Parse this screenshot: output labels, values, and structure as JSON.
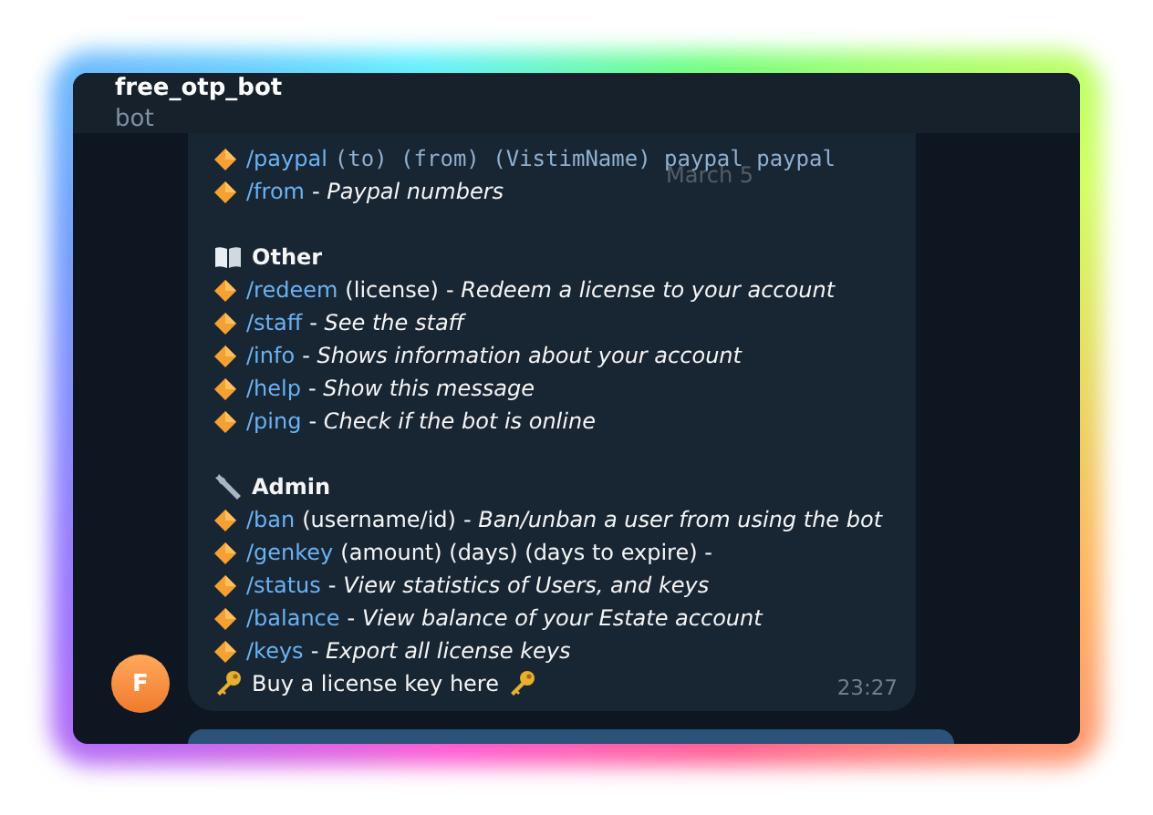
{
  "header": {
    "title": "free_otp_bot",
    "subtitle": "bot"
  },
  "date_badge": "March 5",
  "avatar": {
    "letter": "F"
  },
  "message": {
    "sections": [
      {
        "lines": [
          {
            "command": "/paypal",
            "args": "(to) (from) (VistimName) paypal paypal",
            "kind": "mono"
          },
          {
            "command": "/from",
            "description": "- *Paypal numbers*"
          }
        ]
      },
      {
        "heading": "Other",
        "lines": [
          {
            "command": "/redeem",
            "args": "(license)",
            "kind": "plain",
            "description": "- *Redeem a license to your account*"
          },
          {
            "command": "/staff",
            "description": "- *See the staff*"
          },
          {
            "command": "/info",
            "description": "- *Shows information about your account*"
          },
          {
            "command": "/help",
            "description": "- *Show this message*"
          },
          {
            "command": "/ping",
            "description": "- *Check if the bot is online*"
          }
        ]
      },
      {
        "heading": "Admin",
        "lines": [
          {
            "command": "/ban",
            "args": "(username/id)",
            "kind": "plain",
            "description": "- *Ban/unban a user from using the bot*"
          },
          {
            "command": "/genkey",
            "args": "(amount) (days) (days to expire) -",
            "kind": "plain"
          },
          {
            "command": "/status",
            "description": "- *View statistics of Users, and keys*"
          },
          {
            "command": "/balance",
            "description": "- *View balance of your Estate account*"
          },
          {
            "command": "/keys",
            "description": "- *Export all license keys*"
          }
        ]
      }
    ],
    "footer": "Buy a license key here",
    "time": "23:27"
  }
}
